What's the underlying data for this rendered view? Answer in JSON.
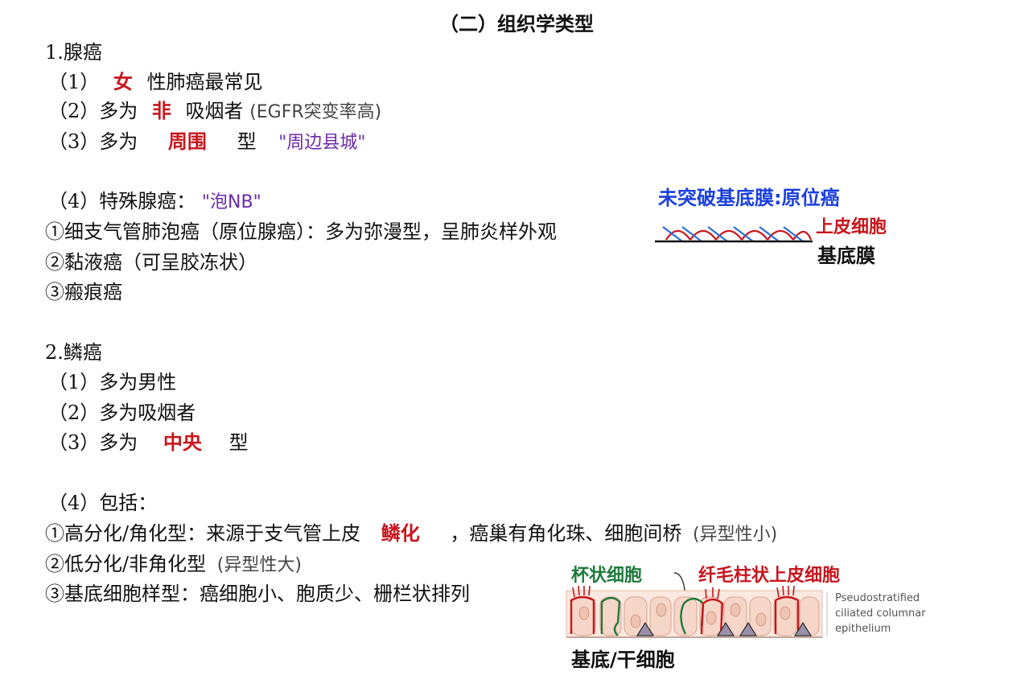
{
  "title": "（二）组织学类型",
  "adeno": {
    "heading": "1.腺癌",
    "i1_prefix": "（1）",
    "i1_hl": "女",
    "i1_suffix": "性肺癌最常见",
    "i2_prefix": "（2）多为",
    "i2_hl": "非",
    "i2_mid": "吸烟者",
    "i2_note": "(EGFR突变率高)",
    "i3_prefix": "（3）多为",
    "i3_hl": "周围",
    "i3_mid": "型",
    "i3_note": "\"周边县城\"",
    "i4_prefix": "（4）特殊腺癌：",
    "i4_note": "\"泡NB\"",
    "sub1": "①细支气管肺泡癌（原位腺癌）：多为弥漫型，呈肺炎样外观",
    "sub2": "②黏液癌（可呈胶冻状）",
    "sub3": "③瘢痕癌"
  },
  "squamous": {
    "heading": "2.鳞癌",
    "i1": "（1）多为男性",
    "i2": "（2）多为吸烟者",
    "i3_prefix": "（3）多为",
    "i3_hl": "中央",
    "i3_suffix": "型",
    "i4": "（4）包括：",
    "sub1_prefix": "①高分化/角化型：来源于支气管上皮",
    "sub1_hl": "鳞化",
    "sub1_suffix": "，癌巢有角化珠、细胞间桥",
    "sub1_note": "(异型性小)",
    "sub2_prefix": "②低分化/非角化型",
    "sub2_note": "(异型性大)",
    "sub3": "③基底细胞样型：癌细胞小、胞质少、栅栏状排列"
  },
  "diagram1": {
    "note_top": "未突破基底膜:原位癌",
    "label_epithelium": "上皮细胞",
    "label_membrane": "基底膜"
  },
  "diagram2": {
    "label_goblet": "杯状细胞",
    "label_ciliated": "纤毛柱状上皮细胞",
    "label_basal": "基底/干细胞",
    "caption": [
      "Pseudostratified",
      "ciliated columnar",
      "epithelium"
    ]
  },
  "colors": {
    "highlight_red": "#c8161d",
    "note_purple": "#6a2aa6",
    "note_blue": "#1a3fe0",
    "note_green": "#1f7a3c"
  }
}
